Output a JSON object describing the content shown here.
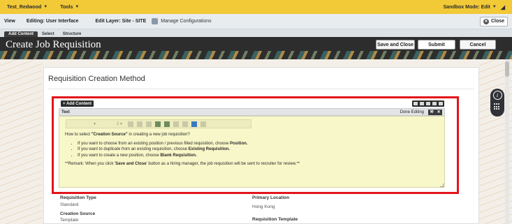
{
  "topbar": {
    "workspace": "Test_Redwood",
    "tools": "Tools",
    "sandbox_mode": "Sandbox Mode: Edit"
  },
  "editbar": {
    "view": "View",
    "editing": "Editing: User Interface",
    "layer": "Edit Layer: Site - SITE",
    "manage": "Manage Configurations",
    "close": "Close"
  },
  "tabs": [
    "Add Content",
    "Select",
    "Structure"
  ],
  "header": {
    "title": "Create Job Requisition",
    "save_close": "Save and Close",
    "submit": "Submit",
    "cancel": "Cancel"
  },
  "section": {
    "heading": "Requisition Creation Method"
  },
  "composer": {
    "add_content": "+ Add Content",
    "text_label": "Text",
    "done_editing": "Done Editing",
    "font_size": "2"
  },
  "rte": {
    "intro_prefix": "How to select ",
    "intro_bold": "\"Creation Source\"",
    "intro_suffix": " in creating a new job requisition?",
    "bullets": [
      {
        "text": "If you want to choose from an existing position / previous filled requisition, choose ",
        "bold": "Position."
      },
      {
        "text": "If you want to duplicate from an existing requisition, choose ",
        "bold": "Existing Requisition."
      },
      {
        "text": "If you want to create a new position, choose ",
        "bold": "Blank Requisition."
      }
    ],
    "remark_prefix": "**Remark: When you click '",
    "remark_bold": "Save and Close",
    "remark_suffix": "' button as a hiring manager, the job requisition will be sent to recruiter for review.**"
  },
  "fields": {
    "requisition_type_label": "Requisition Type",
    "requisition_type_value": "Standard",
    "primary_location_label": "Primary Location",
    "primary_location_value": "Hong Kong",
    "creation_source_label": "Creation Source",
    "creation_source_value": "Template",
    "requisition_template_label": "Requisition Template"
  },
  "colors": {
    "topbar": "#f2c937",
    "highlight": "#e3141b",
    "editor_bg": "#f7f7c9",
    "header_bg": "#2d2d2d"
  }
}
